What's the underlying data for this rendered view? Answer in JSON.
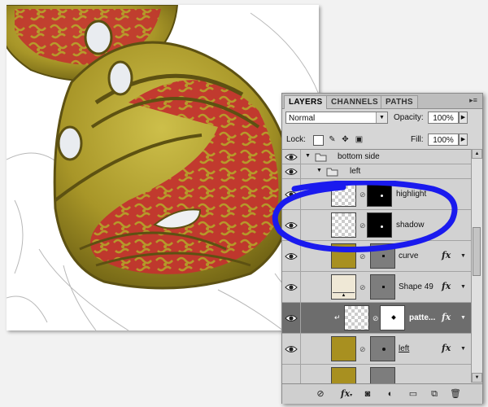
{
  "panel": {
    "tabs": [
      {
        "label": "LAYERS",
        "active": true
      },
      {
        "label": "CHANNELS",
        "active": false
      },
      {
        "label": "PATHS",
        "active": false
      }
    ],
    "menu_icon": "panel-menu-icon",
    "blend_mode": "Normal",
    "opacity_label": "Opacity:",
    "opacity_value": "100%",
    "lock_label": "Lock:",
    "lock_icons": [
      "lock-transparent-pixels-icon",
      "lock-image-pixels-icon",
      "lock-position-icon",
      "lock-all-icon"
    ],
    "fill_label": "Fill:",
    "fill_value": "100%"
  },
  "layers": [
    {
      "type": "group",
      "name": "bottom side",
      "visible": true,
      "expanded": true
    },
    {
      "type": "group",
      "name": "left",
      "visible": true,
      "expanded": true
    },
    {
      "type": "layer",
      "name": "highlight",
      "visible": true,
      "thumb": "transparent",
      "mask": "black",
      "fx": false,
      "selected": false
    },
    {
      "type": "layer",
      "name": "shadow",
      "visible": true,
      "thumb": "transparent",
      "mask": "black",
      "fx": false,
      "selected": false
    },
    {
      "type": "layer",
      "name": "curve",
      "visible": true,
      "thumb": "#a89020",
      "mask": "gray",
      "fx": true,
      "selected": false
    },
    {
      "type": "layer",
      "name": "Shape 49",
      "visible": true,
      "thumb": "#efe8d6",
      "mask": "gray",
      "fx": true,
      "selected": false
    },
    {
      "type": "layer",
      "name": "patte...",
      "visible": true,
      "thumb": "transparent",
      "mask": "white",
      "fx": true,
      "selected": true
    },
    {
      "type": "layer",
      "name": "left",
      "visible": true,
      "thumb": "#a89020",
      "mask": "gray",
      "fx": true,
      "selected": false
    }
  ],
  "footer_icons": [
    "link-layers-icon",
    "fx-icon",
    "add-mask-icon",
    "adjustment-layer-icon",
    "new-group-icon",
    "new-layer-icon",
    "trash-icon"
  ],
  "fx_symbol": "fx",
  "colors": {
    "mask_gold": "#a89020",
    "highlight_ellipse": "#1a1aee",
    "pattern_red": "#c03030",
    "selected_row": "#6d6d6d"
  }
}
